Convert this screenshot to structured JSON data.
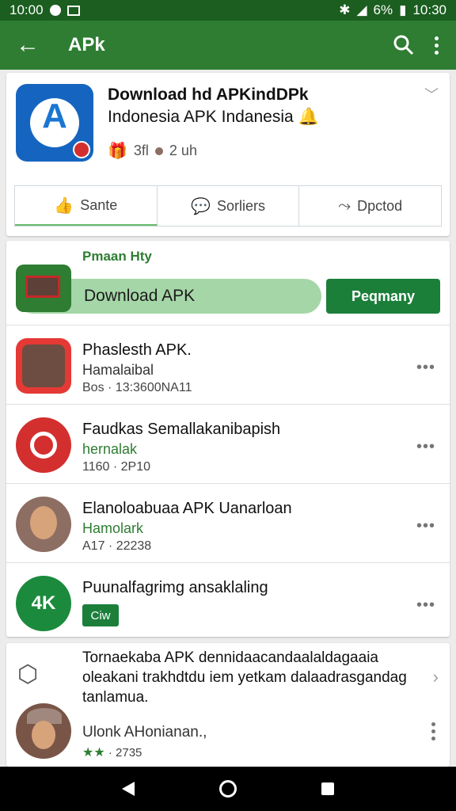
{
  "status_bar": {
    "time_left": "10:00",
    "battery": "6%",
    "time_right": "10:30"
  },
  "app_bar": {
    "title": "APk"
  },
  "app_header": {
    "title_line1": "Download hd APKindDPk",
    "title_line2": "Indonesia APK Indanesia",
    "meta_rating": "3fl",
    "meta_time": "2 uh"
  },
  "actions": [
    {
      "label": "Sante",
      "icon": "thumbs-up-icon"
    },
    {
      "label": "Sorliers",
      "icon": "message-icon"
    },
    {
      "label": "Dpctod",
      "icon": "share-icon"
    }
  ],
  "promo": {
    "label": "Pmaan Hty",
    "text": "Download APK",
    "button": "Peqmany"
  },
  "list": [
    {
      "title": "Phaslesth APK.",
      "subtitle": "Hamalaibal",
      "meta": "Bos · 13:3600NA11"
    },
    {
      "title": "Faudkas Semallakanibapish",
      "subtitle": "hernalak",
      "meta": "1160 · 2P10"
    },
    {
      "title": "Elanoloabuaa APK Uanarloan",
      "subtitle": "Hamolark",
      "meta": "A17 · 22238"
    },
    {
      "title": "Puunalfagrimg ansaklaling",
      "tag": "Ciw",
      "avatar_text": "4K"
    }
  ],
  "tip": {
    "text": "Tornaekaba APK dennidaacandaalaldagaaia oleakani trakhdtdu iem yetkam dalaadrasgandag tanlamua."
  },
  "review": {
    "name": "Ulonk AHonianan.,",
    "stars": "★★",
    "meta": "· 2735"
  }
}
